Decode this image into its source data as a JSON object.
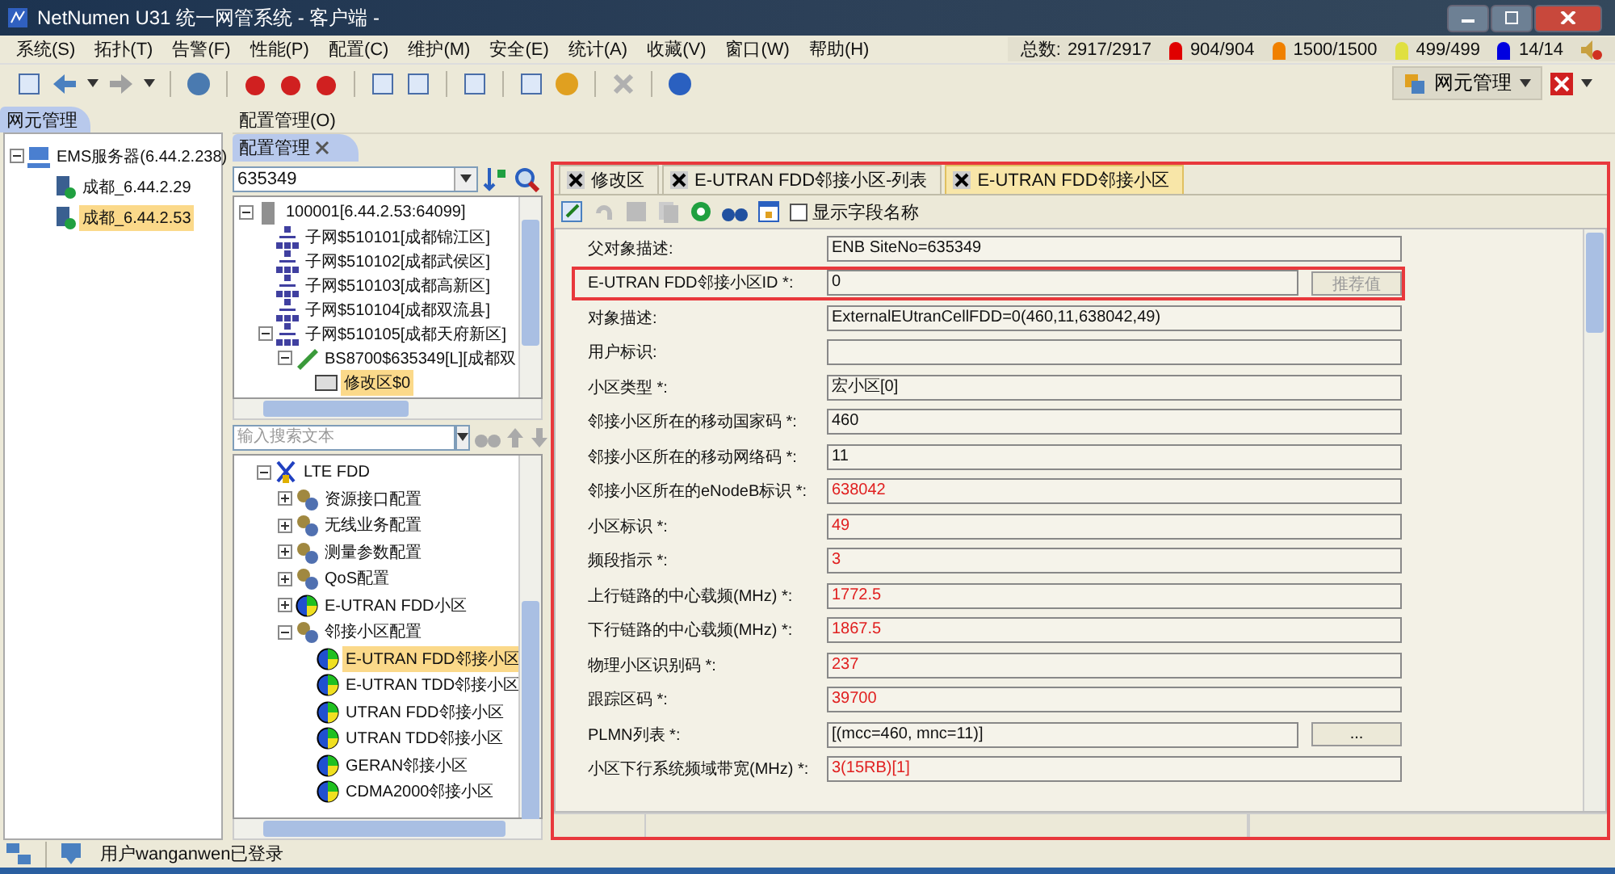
{
  "window": {
    "title": "NetNumen U31 统一网管系统 - 客户端 -"
  },
  "menu": [
    "系统(S)",
    "拓扑(T)",
    "告警(F)",
    "性能(P)",
    "配置(C)",
    "维护(M)",
    "安全(E)",
    "统计(A)",
    "收藏(V)",
    "窗口(W)",
    "帮助(H)"
  ],
  "alarm_summary": {
    "label": "总数:",
    "total": "2917/2917",
    "counts": [
      {
        "value": "904/904",
        "color": "#e00000"
      },
      {
        "value": "1500/1500",
        "color": "#f08000"
      },
      {
        "value": "499/499",
        "color": "#e0e040"
      },
      {
        "value": "14/14",
        "color": "#0000e0"
      }
    ]
  },
  "perspective": {
    "label": "网元管理"
  },
  "left_panel": {
    "tab": "网元管理",
    "tree": [
      {
        "label": "EMS服务器(6.44.2.238)",
        "kind": "server",
        "expanded": true,
        "selected": false,
        "children": [
          {
            "label": "成都_6.44.2.29",
            "kind": "ne",
            "selected": false
          },
          {
            "label": "成都_6.44.2.53",
            "kind": "ne",
            "selected": true
          }
        ]
      }
    ]
  },
  "config_bar": {
    "title": "配置管理(O)",
    "tab": "配置管理"
  },
  "ne_selector": {
    "value": "635349"
  },
  "ne_tree": [
    {
      "label": "100001[6.44.2.53:64099]",
      "kind": "host",
      "expanded": true,
      "selected": false,
      "children": [
        {
          "label": "子网$510101[成都锦江区]",
          "kind": "subnet",
          "selected": false
        },
        {
          "label": "子网$510102[成都武侯区]",
          "kind": "subnet",
          "selected": false
        },
        {
          "label": "子网$510103[成都高新区]",
          "kind": "subnet",
          "selected": false
        },
        {
          "label": "子网$510104[成都双流县]",
          "kind": "subnet",
          "selected": false
        },
        {
          "label": "子网$510105[成都天府新区]",
          "kind": "subnet",
          "expanded": true,
          "selected": false,
          "children": [
            {
              "label": "BS8700$635349[L][成都双",
              "kind": "station",
              "expanded": true,
              "selected": false,
              "children": [
                {
                  "label": "修改区$0",
                  "kind": "area",
                  "selected": true
                }
              ]
            }
          ]
        }
      ]
    }
  ],
  "tree_search": {
    "placeholder": "输入搜索文本"
  },
  "object_tree": [
    {
      "label": "LTE FDD",
      "kind": "lte",
      "expanded": true,
      "selected": false,
      "children": [
        {
          "label": "资源接口配置",
          "kind": "gear",
          "expanded": false,
          "selected": false
        },
        {
          "label": "无线业务配置",
          "kind": "gear",
          "expanded": false,
          "selected": false
        },
        {
          "label": "测量参数配置",
          "kind": "gear",
          "expanded": false,
          "selected": false
        },
        {
          "label": "QoS配置",
          "kind": "gear",
          "expanded": false,
          "selected": false
        },
        {
          "label": "E-UTRAN FDD小区",
          "kind": "cell",
          "expanded": false,
          "selected": false
        },
        {
          "label": "邻接小区配置",
          "kind": "gear",
          "expanded": true,
          "selected": false,
          "children": [
            {
              "label": "E-UTRAN FDD邻接小区",
              "kind": "cell",
              "selected": true
            },
            {
              "label": "E-UTRAN TDD邻接小区",
              "kind": "cell",
              "selected": false
            },
            {
              "label": "UTRAN FDD邻接小区",
              "kind": "cell",
              "selected": false
            },
            {
              "label": "UTRAN TDD邻接小区",
              "kind": "cell",
              "selected": false
            },
            {
              "label": "GERAN邻接小区",
              "kind": "cell",
              "selected": false
            },
            {
              "label": "CDMA2000邻接小区",
              "kind": "cell",
              "selected": false
            }
          ]
        }
      ]
    }
  ],
  "editor": {
    "annotated": true,
    "tabs": [
      {
        "label": "修改区",
        "selected": false
      },
      {
        "label": "E-UTRAN FDD邻接小区-列表",
        "selected": false
      },
      {
        "label": "E-UTRAN FDD邻接小区",
        "selected": true
      }
    ],
    "show_field_names": {
      "label": "显示字段名称",
      "checked": false
    },
    "fields": [
      {
        "label": "父对象描述:",
        "value": "ENB SiteNo=635349",
        "highlighted": false,
        "annotated": false
      },
      {
        "label": "E-UTRAN FDD邻接小区ID *:",
        "value": "0",
        "highlighted": false,
        "annotated": true,
        "button": {
          "label": "推荐值",
          "disabled": true
        }
      },
      {
        "label": "对象描述:",
        "value": "ExternalEUtranCellFDD=0(460,11,638042,49)",
        "highlighted": false,
        "annotated": false
      },
      {
        "label": "用户标识:",
        "annotated": false
      },
      {
        "label": "小区类型 *:",
        "value": "宏小区[0]",
        "highlighted": false,
        "annotated": false
      },
      {
        "label": "邻接小区所在的移动国家码 *:",
        "value": "460",
        "highlighted": false,
        "annotated": false
      },
      {
        "label": "邻接小区所在的移动网络码 *:",
        "value": "11",
        "highlighted": false,
        "annotated": false
      },
      {
        "label": "邻接小区所在的eNodeB标识 *:",
        "value": "638042",
        "highlighted": true,
        "annotated": false
      },
      {
        "label": "小区标识 *:",
        "value": "49",
        "highlighted": true,
        "annotated": false
      },
      {
        "label": "频段指示 *:",
        "value": "3",
        "highlighted": true,
        "annotated": false
      },
      {
        "label": "上行链路的中心载频(MHz) *:",
        "value": "1772.5",
        "highlighted": true,
        "annotated": false
      },
      {
        "label": "下行链路的中心载频(MHz) *:",
        "value": "1867.5",
        "highlighted": true,
        "annotated": false
      },
      {
        "label": "物理小区识别码 *:",
        "value": "237",
        "highlighted": true,
        "annotated": false
      },
      {
        "label": "跟踪区码 *:",
        "value": "39700",
        "highlighted": true,
        "annotated": false
      },
      {
        "label": "PLMN列表 *:",
        "value": "[(mcc=460, mnc=11)]",
        "highlighted": false,
        "annotated": false,
        "button": {
          "label": "...",
          "disabled": false
        }
      },
      {
        "label": "小区下行系统频域带宽(MHz) *:",
        "value": "3(15RB)[1]",
        "highlighted": true,
        "annotated": false
      }
    ]
  },
  "status_bar": {
    "text": "用户wanganwen已登录"
  }
}
